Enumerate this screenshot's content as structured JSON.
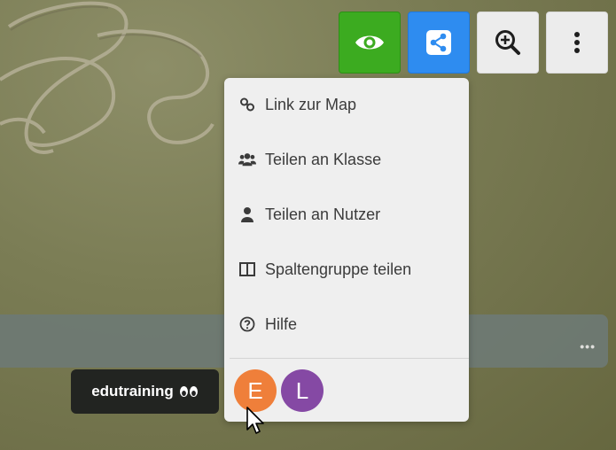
{
  "toolbar": {
    "buttons": [
      {
        "name": "view",
        "icon": "eye-icon",
        "color": "#3cab20"
      },
      {
        "name": "share",
        "icon": "share-icon",
        "color": "#2e8cf0"
      },
      {
        "name": "zoom",
        "icon": "zoom-in-icon",
        "color": "#ececec"
      },
      {
        "name": "more",
        "icon": "vertical-dots-icon",
        "color": "#ececec"
      }
    ]
  },
  "share_menu": {
    "items": [
      {
        "label": "Link zur Map",
        "icon": "link-icon"
      },
      {
        "label": "Teilen an Klasse",
        "icon": "users-icon"
      },
      {
        "label": "Teilen an Nutzer",
        "icon": "user-icon"
      },
      {
        "label": "Spaltengruppe teilen",
        "icon": "columns-icon"
      },
      {
        "label": "Hilfe",
        "icon": "help-icon"
      }
    ],
    "users": [
      {
        "initial": "E",
        "color": "#ef7f3a"
      },
      {
        "initial": "L",
        "color": "#8549a4"
      }
    ]
  },
  "tooltip": {
    "text": "edutraining",
    "icon": "eyes-icon"
  },
  "column_bar": {
    "more_label": "•••"
  }
}
